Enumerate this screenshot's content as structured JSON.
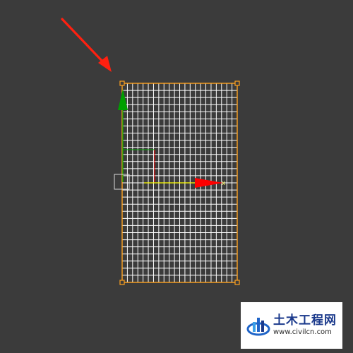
{
  "viewport": {
    "background": "#3b3b3b",
    "selection_color": "#ffa21f",
    "grid_line_color": "#ffffff",
    "grid": {
      "columns": 22,
      "rows": 28
    }
  },
  "gizmo": {
    "x_axis_color": "#ff0000",
    "y_axis_color": "#00a000",
    "plane_color": "#ffff00",
    "x_label": "x"
  },
  "annotation": {
    "arrow_color": "#ff2010"
  },
  "watermark": {
    "title": "土木工程网",
    "url": "www.civilcn.com",
    "logo_colors": [
      "#1f64c8",
      "#39a0e8",
      "#1b3a8c"
    ]
  }
}
